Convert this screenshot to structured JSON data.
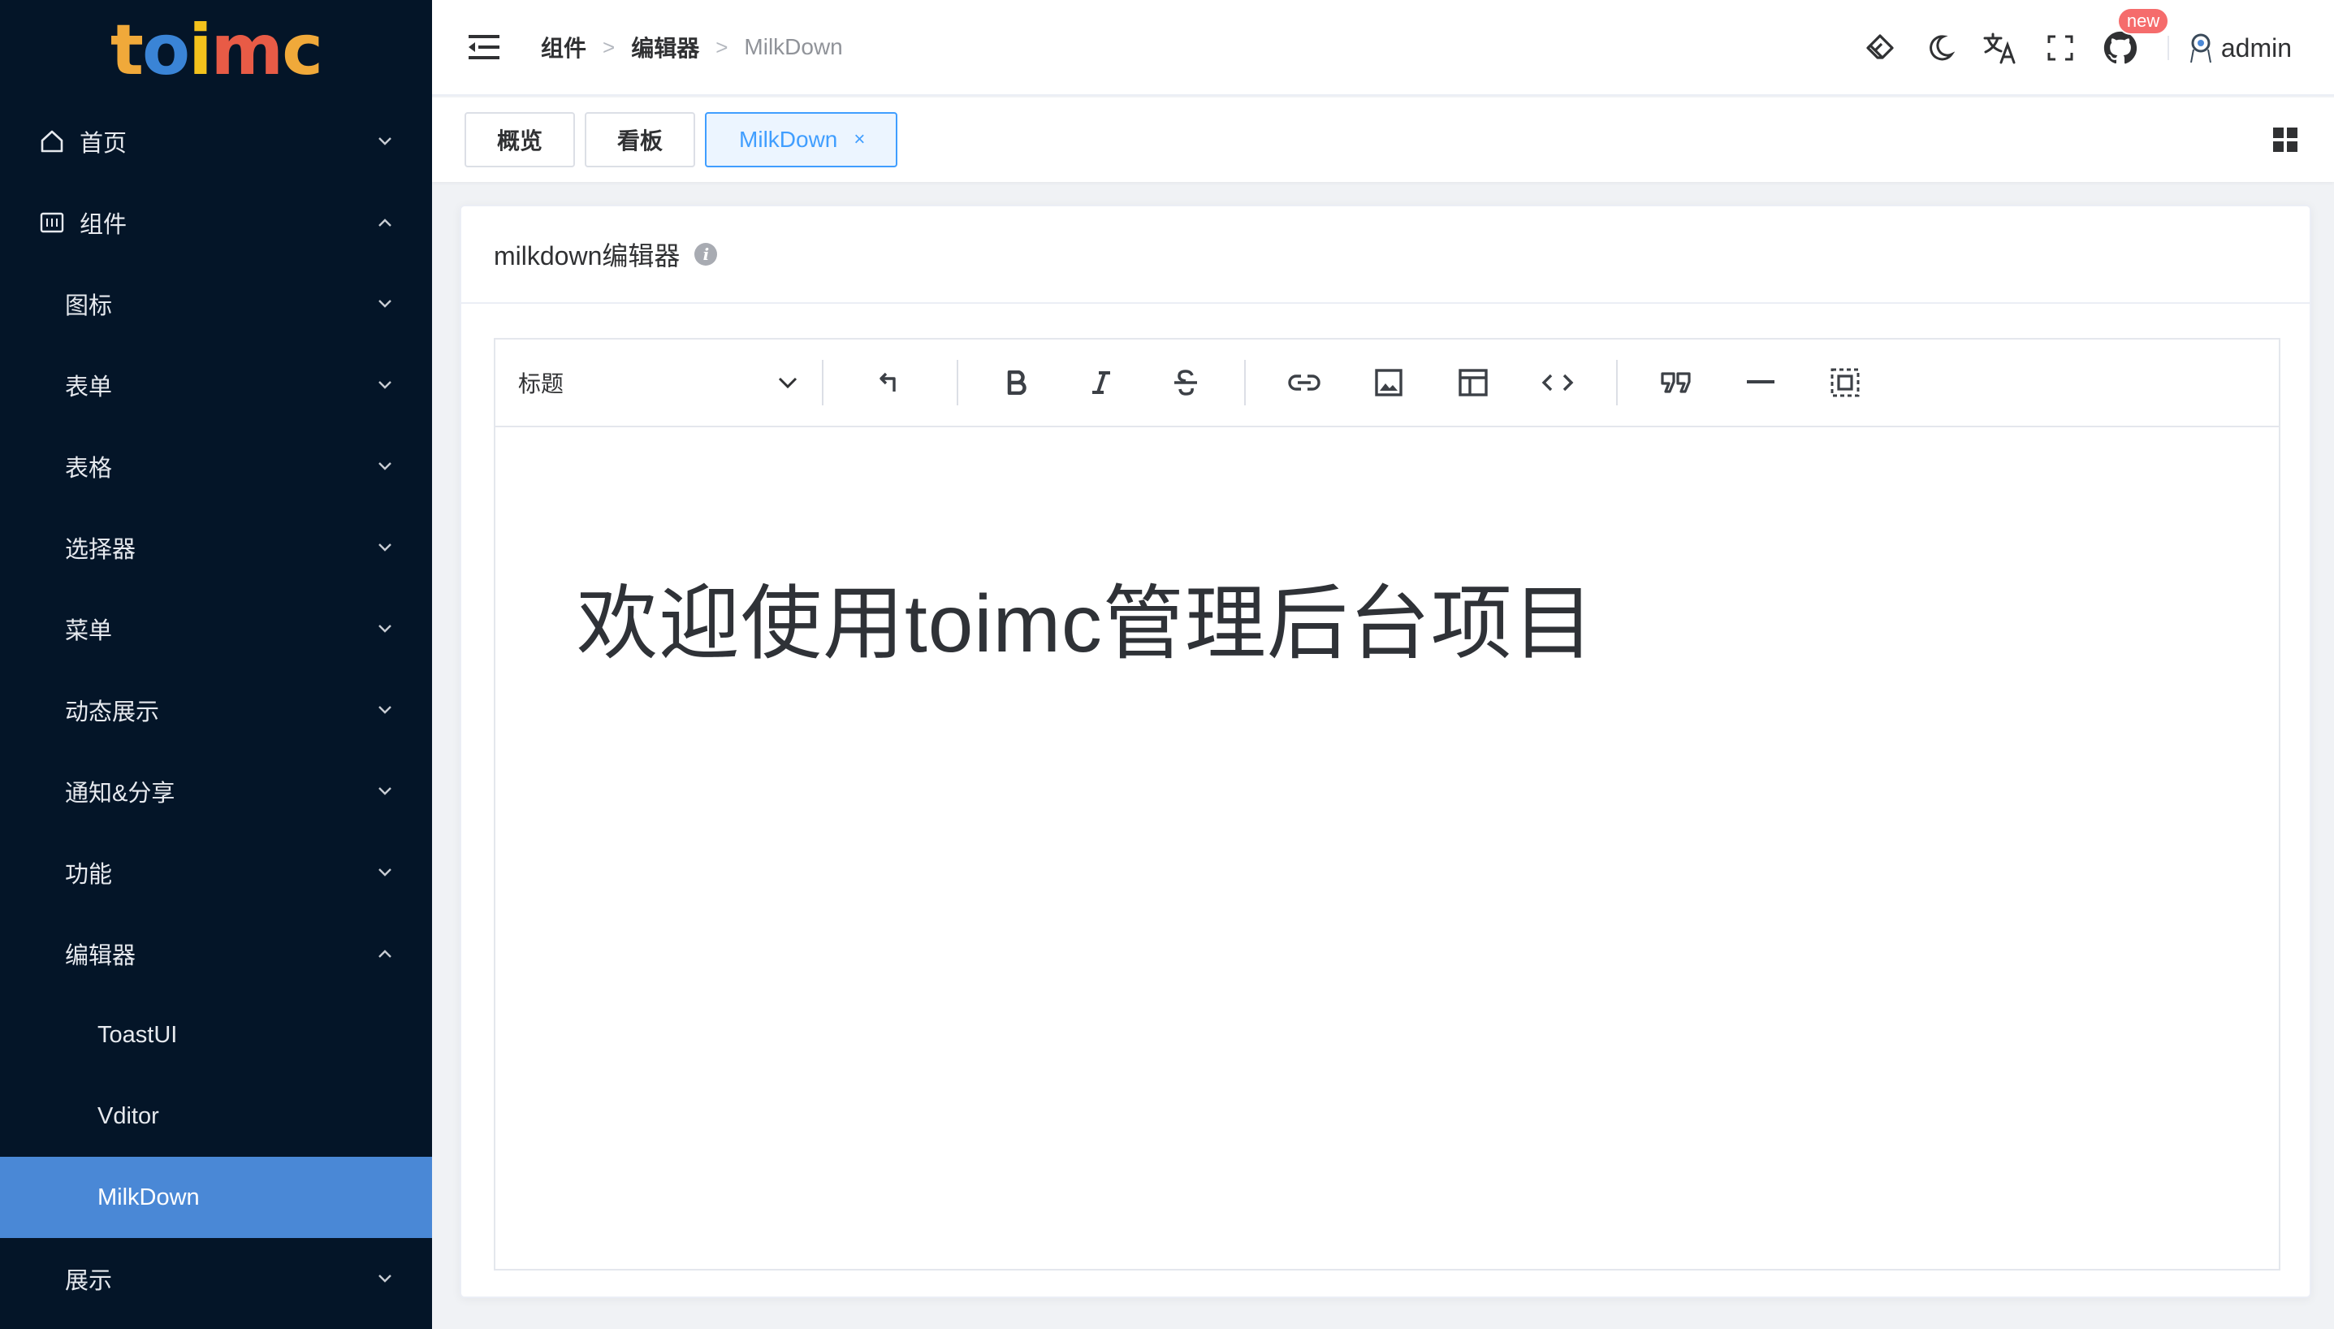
{
  "logo": {
    "text": "toimc",
    "colors": [
      "#f0a93a",
      "#3a84d6",
      "#f3c21c",
      "#e85b46",
      "#f0a93a"
    ]
  },
  "sidebar": {
    "items": [
      {
        "label": "首页",
        "level": 1,
        "icon": "home-icon",
        "expanded": false
      },
      {
        "label": "组件",
        "level": 1,
        "icon": "component-icon",
        "expanded": true
      },
      {
        "label": "图标",
        "level": 2,
        "expanded": false
      },
      {
        "label": "表单",
        "level": 2,
        "expanded": false
      },
      {
        "label": "表格",
        "level": 2,
        "expanded": false
      },
      {
        "label": "选择器",
        "level": 2,
        "expanded": false
      },
      {
        "label": "菜单",
        "level": 2,
        "expanded": false
      },
      {
        "label": "动态展示",
        "level": 2,
        "expanded": false
      },
      {
        "label": "通知&分享",
        "level": 2,
        "expanded": false
      },
      {
        "label": "功能",
        "level": 2,
        "expanded": false
      },
      {
        "label": "编辑器",
        "level": 2,
        "expanded": true
      },
      {
        "label": "ToastUI",
        "level": 3
      },
      {
        "label": "Vditor",
        "level": 3
      },
      {
        "label": "MilkDown",
        "level": 3,
        "active": true
      },
      {
        "label": "展示",
        "level": 2,
        "expanded": false
      }
    ]
  },
  "header": {
    "breadcrumb": [
      "组件",
      "编辑器",
      "MilkDown"
    ],
    "github_badge": "new",
    "username": "admin"
  },
  "tabs": [
    {
      "label": "概览",
      "active": false
    },
    {
      "label": "看板",
      "active": false
    },
    {
      "label": "MilkDown",
      "active": true,
      "close": "×"
    }
  ],
  "card": {
    "title": "milkdown编辑器",
    "info": "i"
  },
  "editor": {
    "heading_select": "标题",
    "content_heading": "欢迎使用toimc管理后台项目"
  },
  "colors": {
    "sidebar_bg": "#041528",
    "active_item": "#4a88d6",
    "accent": "#409eff",
    "badge": "#f56c6c"
  }
}
